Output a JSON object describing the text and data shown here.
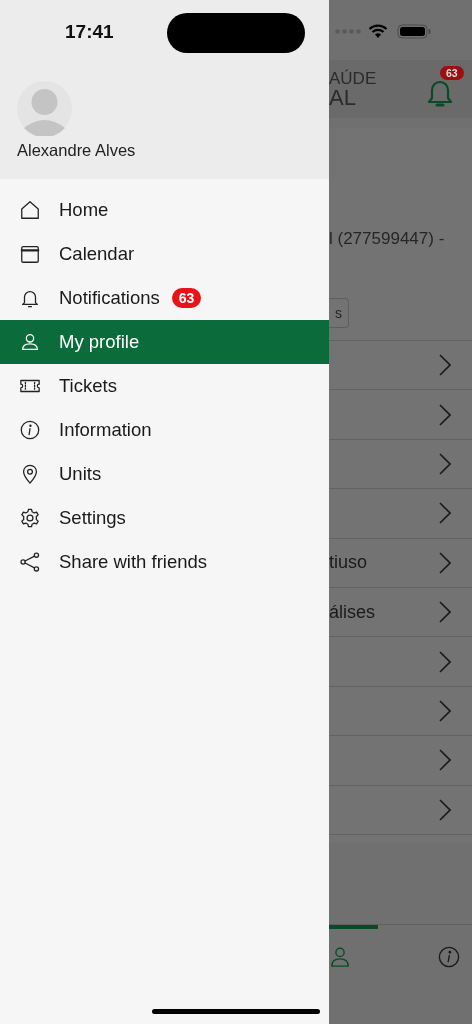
{
  "status_bar": {
    "time": "17:41"
  },
  "drawer": {
    "user_name": "Alexandre Alves",
    "items": [
      {
        "label": "Home",
        "kind": "home",
        "selected": false
      },
      {
        "label": "Calendar",
        "kind": "calendar",
        "selected": false
      },
      {
        "label": "Notifications",
        "kind": "bell",
        "selected": false,
        "badge": "63"
      },
      {
        "label": "My profile",
        "kind": "person",
        "selected": true
      },
      {
        "label": "Tickets",
        "kind": "ticket",
        "selected": false
      },
      {
        "label": "Information",
        "kind": "info",
        "selected": false
      },
      {
        "label": "Units",
        "kind": "pin",
        "selected": false
      },
      {
        "label": "Settings",
        "kind": "gear",
        "selected": false
      },
      {
        "label": "Share with friends",
        "kind": "share",
        "selected": false
      }
    ]
  },
  "background": {
    "header": {
      "title_line_1": "AÚDE",
      "title_line_2": "AL",
      "badge": "63"
    },
    "card": {
      "text": "l (277599447) -",
      "button": "s"
    },
    "rows": [
      {},
      {},
      {},
      {},
      {
        "label": "tiuso"
      },
      {
        "label": "álises"
      },
      {},
      {},
      {},
      {}
    ],
    "tabs": [
      {
        "kind": "person",
        "selected": true
      },
      {
        "kind": "info",
        "selected": false
      }
    ]
  }
}
